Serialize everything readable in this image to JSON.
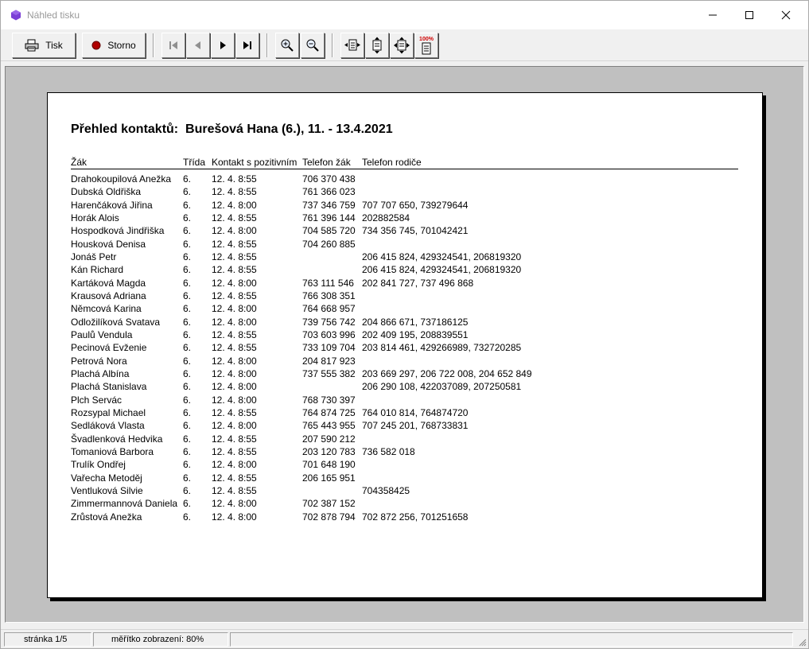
{
  "window": {
    "title": "Náhled tisku",
    "controls": {
      "minimize_icon": "minimize-icon",
      "maximize_icon": "maximize-icon",
      "close_icon": "close-icon"
    }
  },
  "toolbar": {
    "print_label": "Tisk",
    "cancel_label": "Storno",
    "zoom_100_badge": "100%",
    "icons": [
      "printer-icon",
      "stop-icon",
      "first-page-icon",
      "prev-page-icon",
      "next-page-icon",
      "last-page-icon",
      "zoom-in-icon",
      "zoom-out-icon",
      "fit-width-icon",
      "fit-height-icon",
      "fit-page-icon",
      "zoom-100-icon"
    ]
  },
  "report": {
    "title": "Přehled kontaktů:  Burešová Hana (6.), 11. - 13.4.2021",
    "columns": [
      "Žák",
      "Třída",
      "Kontakt s pozitivním",
      "Telefon žák",
      "Telefon rodiče"
    ],
    "rows": [
      [
        "Drahokoupilová Anežka",
        "6.",
        "12. 4.  8:55",
        "706 370 438",
        ""
      ],
      [
        "Dubská Oldřiška",
        "6.",
        "12. 4.  8:55",
        "761 366 023",
        ""
      ],
      [
        "Harenčáková Jiřina",
        "6.",
        "12. 4.  8:00",
        "737 346 759",
        "707 707 650, 739279644"
      ],
      [
        "Horák Alois",
        "6.",
        "12. 4.  8:55",
        "761 396 144",
        "202882584"
      ],
      [
        "Hospodková Jindřiška",
        "6.",
        "12. 4.  8:00",
        "704 585 720",
        "734 356 745, 701042421"
      ],
      [
        "Housková Denisa",
        "6.",
        "12. 4.  8:55",
        "704 260 885",
        ""
      ],
      [
        "Jonáš Petr",
        "6.",
        "12. 4.  8:55",
        "",
        "206 415 824, 429324541, 206819320"
      ],
      [
        "Kán Richard",
        "6.",
        "12. 4.  8:55",
        "",
        "206 415 824, 429324541, 206819320"
      ],
      [
        "Kartáková Magda",
        "6.",
        "12. 4.  8:00",
        "763 111 546",
        "202 841 727, 737 496 868"
      ],
      [
        "Krausová Adriana",
        "6.",
        "12. 4.  8:55",
        "766 308 351",
        ""
      ],
      [
        "Němcová Karina",
        "6.",
        "12. 4.  8:00",
        "764 668 957",
        ""
      ],
      [
        "Odložilíková Svatava",
        "6.",
        "12. 4.  8:00",
        "739 756 742",
        "204 866 671, 737186125"
      ],
      [
        "Paulů Vendula",
        "6.",
        "12. 4.  8:55",
        "703 603 996",
        "202 409 195, 208839551"
      ],
      [
        "Pecinová Evženie",
        "6.",
        "12. 4.  8:55",
        "733 109 704",
        "203 814 461, 429266989, 732720285"
      ],
      [
        "Petrová Nora",
        "6.",
        "12. 4.  8:00",
        "204 817 923",
        ""
      ],
      [
        "Plachá Albína",
        "6.",
        "12. 4.  8:00",
        "737 555 382",
        "203 669 297, 206 722 008, 204 652 849"
      ],
      [
        "Plachá Stanislava",
        "6.",
        "12. 4.  8:00",
        "",
        "206 290 108, 422037089, 207250581"
      ],
      [
        "Plch Servác",
        "6.",
        "12. 4.  8:00",
        "768 730 397",
        ""
      ],
      [
        "Rozsypal Michael",
        "6.",
        "12. 4.  8:55",
        "764 874 725",
        "764 010 814, 764874720"
      ],
      [
        "Sedláková Vlasta",
        "6.",
        "12. 4.  8:00",
        "765 443 955",
        "707 245 201, 768733831"
      ],
      [
        "Švadlenková Hedvika",
        "6.",
        "12. 4.  8:55",
        "207 590 212",
        ""
      ],
      [
        "Tomaniová Barbora",
        "6.",
        "12. 4.  8:55",
        "203 120 783",
        "736 582 018"
      ],
      [
        "Trulík Ondřej",
        "6.",
        "12. 4.  8:00",
        "701 648 190",
        ""
      ],
      [
        "Vařecha Metoděj",
        "6.",
        "12. 4.  8:55",
        "206 165 951",
        ""
      ],
      [
        "Ventluková Silvie",
        "6.",
        "12. 4.  8:55",
        "",
        "704358425"
      ],
      [
        "Zimmermannová Daniela",
        "6.",
        "12. 4.  8:00",
        "702 387 152",
        ""
      ],
      [
        "Zrůstová Anežka",
        "6.",
        "12. 4.  8:00",
        "702 878 794",
        "702 872 256, 701251658"
      ]
    ]
  },
  "status": {
    "page": "stránka 1/5",
    "zoom": "měřítko zobrazení: 80%"
  },
  "colors": {
    "app_icon": "#7b3fd6",
    "stop_red": "#b00000",
    "badge_red": "#d00000",
    "preview_bg": "#c0c0c0"
  }
}
